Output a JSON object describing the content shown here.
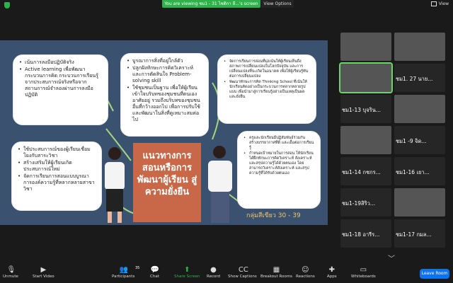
{
  "top": {
    "banner": "You are viewing ชม1 - 31 ไชติกา ลี...'s screen",
    "view_options": "View Options",
    "view": "View"
  },
  "slide": {
    "title": "แนวทางการ สอนหรือการ พัฒนาผู้เรียน สู่ความยั่งยืน",
    "group": "กลุ่มสีเขียว 30 - 39",
    "box_top_left": [
      "เน้นการลงมือปฏิบัติจริง",
      "Active learning เพื่อพัฒนากระบวนการคิด กระบวนการเรียนรู้จากประสบการณ์จริงหรือจากสถานการณ์จำลองผ่านการลงมือปฏิบัติ"
    ],
    "box_top_mid": [
      "บูรณาการสิ่งที่อยู่ใกล้ตัว",
      "ปลูกฝังทักษะการคิดวิเคราะห์ และการตัดสินใจ Problem-solving skill",
      "ใช้ชุมชนเป็นฐาน เพื่อให้ผู้เรียนเข้าใจบริบทของชุมชนที่ตนเองอาศัยอยู่ รวมถึงบริบทของชุมชนอื่นที่กว้างออกไป เพื่อการปรับใช้และพัฒนาในสิ่งที่ดูเหมาะสมต่อไป"
    ],
    "box_top_right": [
      "จัดการเรียนการสอนที่มุ่งเน้นให้ผู้เรียนเห็นถึงสภาพการเปลี่ยนแปลงในโลกปัจจุบัน และการเปลี่ยนแปลงที่จะเกิดในอนาคต เพื่อให้ผู้เรียนรู้ทันต่อการเปลี่ยนแปลง",
      "พัฒนาทักษะการคิด Thinking School ที่เน้นให้นักเรียนคิดอย่างเป็นกระบวนการหลากหลายรูปแบบ เพื่อนำมาสู่การเรียนรู้อย่างเป็นเหตุเป็นผลและยั่งยืน"
    ],
    "box_bottom_left": [
      "ใช้ประสบการณ์ของผู้เรียนเชื่อมโยงกับสาระวิชา",
      "สร้างเสริมให้ผู้เรียนเกิดประสบการณ์ใหม่",
      "จัดการเรียนการสอนแบบบูรณาการองค์ความรู้ที่หลากหลายสาขาวิชา"
    ],
    "box_bottom_right": [
      "ครูและนักเรียนมีปฏิสัมพันธ์ร่วมกัน สร้างบรรยากาศที่ดี และเอื้อต่อการเรียนรู้",
      "กำหนดเป้าหมายในการสอน ให้นักเรียนได้ฝึกทักษะการคิดวิเคราะห์ สังเคราะห์ และสรุปความรู้ได้ด้วยตนเอง โดยสามารถวิเคราะห์สังเคราะห์ และสรุปความรู้ที่ได้รับด้วยตนเอง"
    ]
  },
  "gallery": {
    "tiles": [
      {
        "name": ""
      },
      {
        "name": ""
      },
      {
        "name": ""
      },
      {
        "name": "ชม1. 27 นาย..."
      },
      {
        "name": "ชม1-13 บุจริน..."
      },
      {
        "name": ""
      },
      {
        "name": ""
      },
      {
        "name": "ชม1 -9 จิด..."
      },
      {
        "name": "ชม1-14 กชกร..."
      },
      {
        "name": "ชม1-16 เยา..."
      },
      {
        "name": "ชม1-19สิริว..."
      },
      {
        "name": ""
      },
      {
        "name": "ชม1-18 อารีร..."
      },
      {
        "name": "ชม1-17 กมล..."
      }
    ]
  },
  "toolbar": {
    "unmute": "Unmute",
    "start_video": "Start Video",
    "participants": "Participants",
    "participants_count": "35",
    "chat": "Chat",
    "share_screen": "Share Screen",
    "record": "Record",
    "show_captions": "Show Captions",
    "breakout_rooms": "Breakout Rooms",
    "reactions": "Reactions",
    "apps": "Apps",
    "whiteboards": "Whiteboards",
    "leave": "Leave Room"
  },
  "colors": {
    "accent_green": "#2fb24c",
    "slide_bg": "#3b5170",
    "title_box": "#c96848",
    "leave_blue": "#0e72ed"
  }
}
